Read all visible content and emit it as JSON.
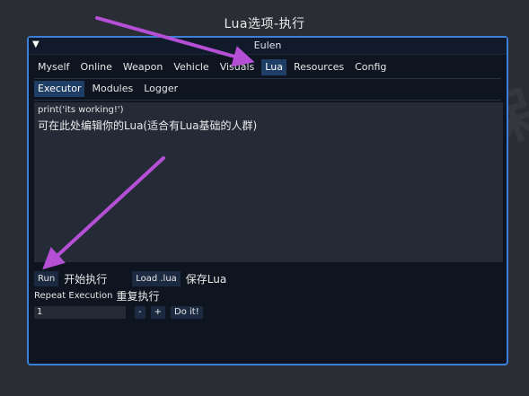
{
  "caption": "Lua选项-执行",
  "window": {
    "title": "Eulen",
    "collapse_glyph": "▼",
    "tabs": [
      {
        "label": "Myself"
      },
      {
        "label": "Online"
      },
      {
        "label": "Weapon"
      },
      {
        "label": "Vehicle"
      },
      {
        "label": "Visuals"
      },
      {
        "label": "Lua",
        "active": true
      },
      {
        "label": "Resources"
      },
      {
        "label": "Config"
      }
    ],
    "subtabs": [
      {
        "label": "Executor",
        "active": true
      },
      {
        "label": "Modules"
      },
      {
        "label": "Logger"
      }
    ],
    "editor": {
      "code": "print('its working!')",
      "hint": "可在此处编辑你的Lua(适合有Lua基础的人群)"
    },
    "run_button": "Run",
    "run_note": "开始执行",
    "load_button": "Load .lua",
    "load_note": "保存Lua",
    "repeat_label": "Repeat Execution",
    "repeat_note": "重复执行",
    "repeat_value": "1",
    "minus_button": "-",
    "plus_button": "+",
    "doit_button": "Do it!"
  },
  "annotation_color": "#b44fd6"
}
